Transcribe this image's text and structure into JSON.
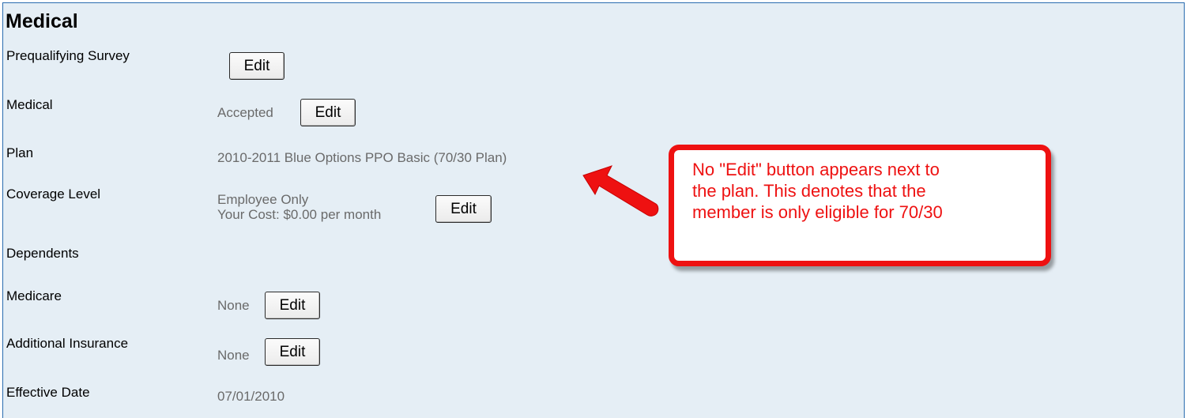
{
  "section": {
    "title": "Medical"
  },
  "rows": {
    "prequalifying": {
      "label": "Prequalifying Survey",
      "button": "Edit"
    },
    "medical": {
      "label": "Medical",
      "value": "Accepted",
      "button": "Edit"
    },
    "plan": {
      "label": "Plan",
      "value": "2010-2011 Blue Options PPO Basic (70/30 Plan)"
    },
    "coverage": {
      "label": "Coverage Level",
      "value_line1": "Employee Only",
      "value_line2": "Your Cost: $0.00 per month",
      "button": "Edit"
    },
    "dependents": {
      "label": "Dependents"
    },
    "medicare": {
      "label": "Medicare",
      "value": "None",
      "button": "Edit"
    },
    "additional_insurance": {
      "label": "Additional Insurance",
      "value": "None",
      "button": "Edit"
    },
    "effective_date": {
      "label": "Effective Date",
      "value": "07/01/2010"
    }
  },
  "callout": {
    "line1": "No \"Edit\" button appears next to",
    "line2": "the plan.  This denotes that the",
    "line3": "member is only eligible for 70/30"
  },
  "colors": {
    "panel_background": "#e5eef5",
    "panel_border": "#2a6cb0",
    "value_text": "#6a6a6a",
    "callout_red": "#ee1111"
  }
}
